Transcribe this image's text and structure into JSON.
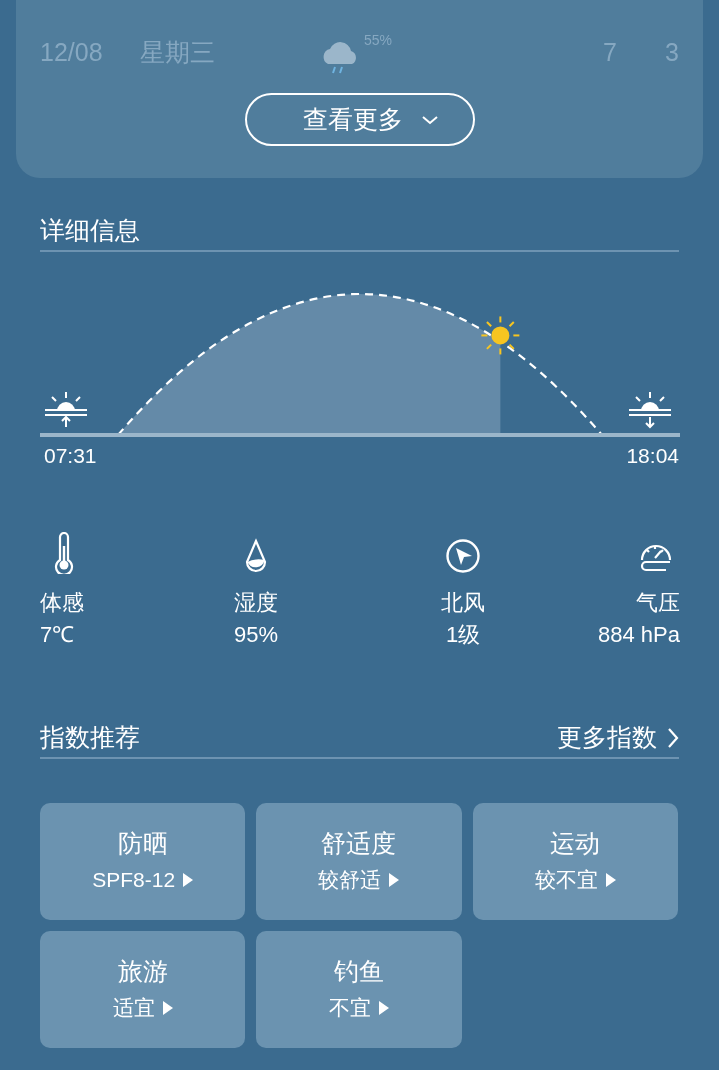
{
  "forecast_row": {
    "date": "12/08",
    "weekday": "星期三",
    "precipitation": "55%",
    "high": "7",
    "low": "3"
  },
  "more_button": {
    "label": "查看更多"
  },
  "details": {
    "title": "详细信息",
    "sunrise": "07:31",
    "sunset": "18:04",
    "sun_position": {
      "level": 0.79
    }
  },
  "stats": [
    {
      "kind": "thermometer",
      "label": "体感",
      "value": "7℃"
    },
    {
      "kind": "drop",
      "label": "湿度",
      "value": "95%"
    },
    {
      "kind": "wind",
      "label": "北风",
      "value": "1级"
    },
    {
      "kind": "pressure",
      "label": "气压",
      "value": "884 hPa"
    }
  ],
  "indices": {
    "title": "指数推荐",
    "more_link": "更多指数",
    "items": [
      {
        "title": "防晒",
        "value": "SPF8-12"
      },
      {
        "title": "舒适度",
        "value": "较舒适"
      },
      {
        "title": "运动",
        "value": "较不宜"
      },
      {
        "title": "旅游",
        "value": "适宜"
      },
      {
        "title": "钓鱼",
        "value": "不宜"
      }
    ]
  }
}
